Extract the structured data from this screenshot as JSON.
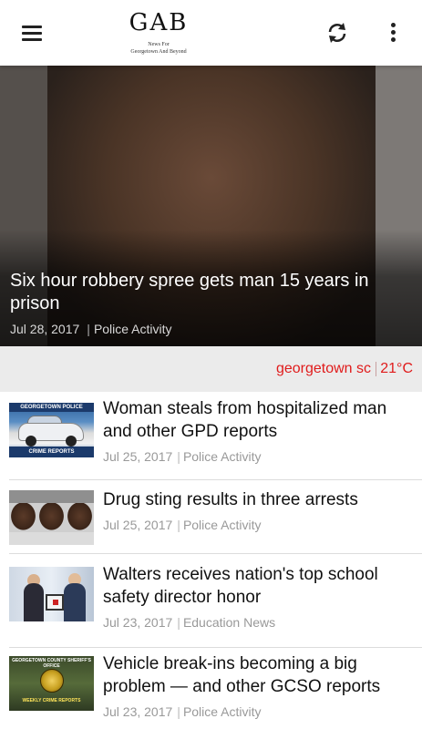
{
  "app_bar": {
    "logo": {
      "mark": "GAB",
      "tagline_1": "News For",
      "tagline_2": "Georgetown And Beyond"
    },
    "icons": {
      "menu": "hamburger-menu-icon",
      "refresh": "refresh-icon",
      "more": "more-vert-icon"
    }
  },
  "featured": {
    "title": "Six hour robbery spree gets man 15 years in prison",
    "date": "Jul 28, 2017",
    "category": "Police Activity"
  },
  "weather": {
    "location": "georgetown sc",
    "temperature": "21°C",
    "accent_color": "#e01b1b"
  },
  "articles": [
    {
      "title": "Woman steals from hospitalized man and other GPD reports",
      "date": "Jul 25, 2017",
      "category": "Police Activity",
      "thumb_text_top": "GEORGETOWN POLICE",
      "thumb_text_bottom": "CRIME REPORTS"
    },
    {
      "title": "Drug sting results in three arrests",
      "date": "Jul 25, 2017",
      "category": "Police Activity"
    },
    {
      "title": "Walters receives nation's top school safety director honor",
      "date": "Jul 23, 2017",
      "category": "Education News"
    },
    {
      "title": "Vehicle break-ins becoming a big problem — and other GCSO reports",
      "date": "Jul 23, 2017",
      "category": "Police Activity",
      "thumb_text_top": "GEORGETOWN COUNTY SHERIFF'S OFFICE",
      "thumb_text_bottom": "WEEKLY CRIME REPORTS"
    }
  ]
}
